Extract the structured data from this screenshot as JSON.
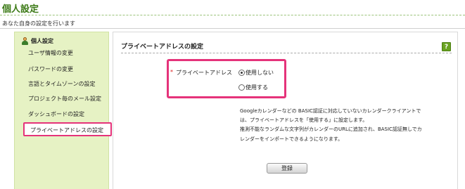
{
  "page": {
    "title": "個人設定",
    "subtitle": "あなた自身の設定を行います"
  },
  "sidebar": {
    "heading": "個人設定",
    "items": [
      {
        "label": "ユーザ情報の変更"
      },
      {
        "label": "パスワードの変更"
      },
      {
        "label": "言語とタイムゾーンの設定"
      },
      {
        "label": "プロジェクト毎のメール設定"
      },
      {
        "label": "ダッシュボードの設定"
      },
      {
        "label": "プライベートアドレスの設定",
        "active": true
      }
    ]
  },
  "main": {
    "section_title": "プライベートアドレスの設定",
    "help_label": "?",
    "field": {
      "required_mark": "*",
      "label": "プライベートアドレス",
      "options": [
        {
          "label": "使用しない",
          "selected": true
        },
        {
          "label": "使用する",
          "selected": false
        }
      ]
    },
    "description": [
      "Googleカレンダーなどの BASIC認証に対応していないカレンダークライアントで",
      "は、プライベートアドレスを「使用する」に設定します。",
      "推測不能なランダムな文字列がカレンダーのURLに追加され、BASIC認証無しでカ",
      "レンダーをインポートできるようになります。"
    ],
    "submit_label": "登録"
  },
  "colors": {
    "title_green": "#3c7a16",
    "sidebar_bg": "#e6f2c4",
    "highlight_pink": "#e5337a",
    "help_green": "#6aa321"
  }
}
